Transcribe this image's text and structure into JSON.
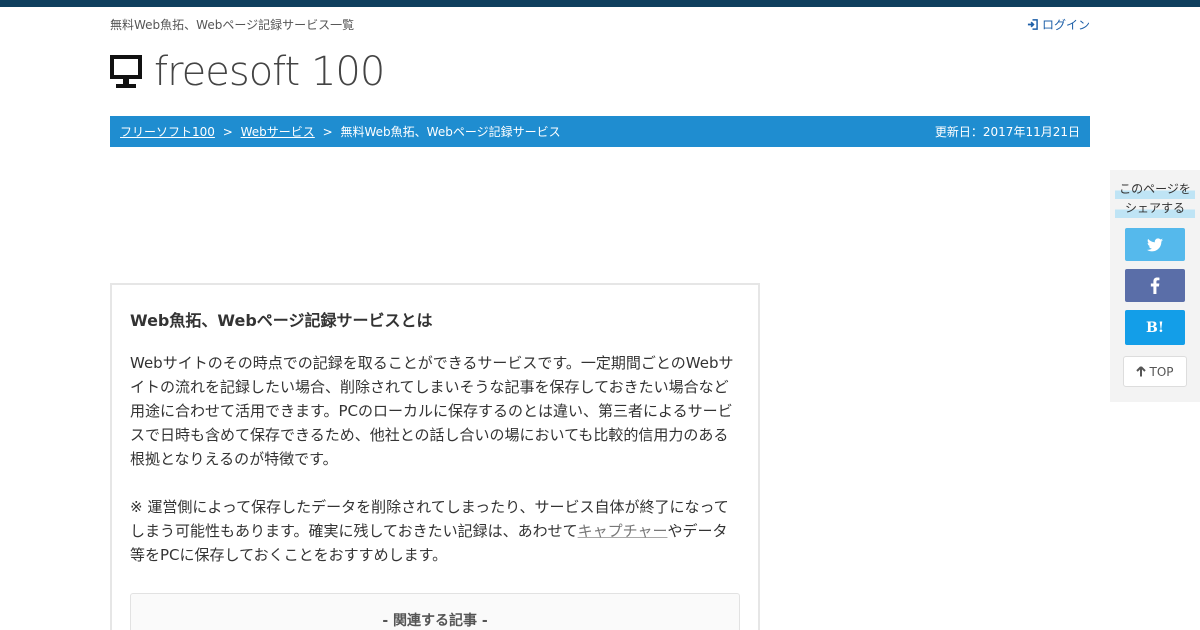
{
  "header": {
    "tagline": "無料Web魚拓、Webページ記録サービス一覧",
    "login_label": "ログイン",
    "logo_text": "freesoft 100"
  },
  "breadcrumb": {
    "items": [
      "フリーソフト100",
      "Webサービス",
      "無料Web魚拓、Webページ記録サービス"
    ],
    "separator": ">",
    "updated": "更新日：2017年11月21日"
  },
  "article": {
    "title": "Web魚拓、Webページ記録サービスとは",
    "para1": "Webサイトのその時点での記録を取ることができるサービスです。一定期間ごとのWebサイトの流れを記録したい場合、削除されてしまいそうな記事を保存しておきたい場合など用途に合わせて活用できます。PCのローカルに保存するのとは違い、第三者によるサービスで日時も含めて保存できるため、他社との話し合いの場においても比較的信用力のある根拠となりえるのが特徴です。",
    "para2_before": "※ 運営側によって保存したデータを削除されてしまったり、サービス自体が終了になってしまう可能性もあります。確実に残しておきたい記録は、あわせて",
    "para2_link": "キャプチャー",
    "para2_after": "やデータ等をPCに保存しておくことをおすすめします。",
    "related_title": "- 関連する記事 -"
  },
  "share": {
    "title_line1": "このページを",
    "title_line2": "シェアする",
    "hatena_label": "B!",
    "top_label": "TOP"
  },
  "colors": {
    "topbar": "#0f3f5e",
    "breadcrumb_bg": "#1f8dd0",
    "twitter": "#55b9ec",
    "facebook": "#5a6ea8",
    "hatena": "#139ee8",
    "login_link": "#1d5fa8"
  },
  "icons": {
    "login": "sign-in-icon",
    "logo": "monitor-icon",
    "twitter": "twitter-bird-icon",
    "facebook": "facebook-f-icon",
    "top": "arrow-up-icon"
  }
}
